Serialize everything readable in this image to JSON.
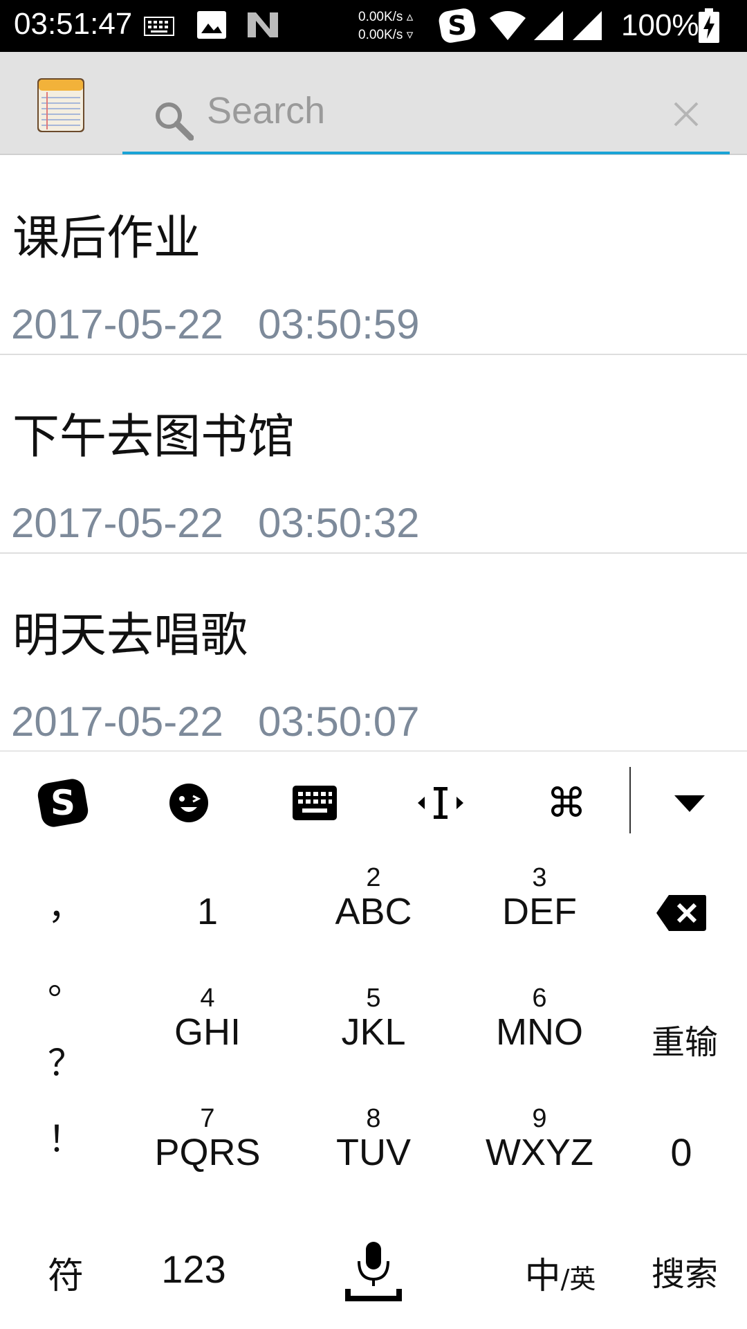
{
  "status_bar": {
    "time": "03:51:47",
    "net_up": "0.00K/s",
    "net_down": "0.00K/s",
    "battery": "100%",
    "icons": [
      "keyboard-icon",
      "image-icon",
      "n-icon",
      "sogou-icon",
      "wifi-icon",
      "signal-icon",
      "signal-icon",
      "battery-charging-icon"
    ]
  },
  "toolbar": {
    "app_icon": "notepad-icon",
    "search_placeholder": "Search",
    "search_value": "",
    "accent_color": "#1aa3d6"
  },
  "notes": [
    {
      "title": "课后作业",
      "date": "2017-05-22",
      "time": "03:50:59"
    },
    {
      "title": "下午去图书馆",
      "date": "2017-05-22",
      "time": "03:50:32"
    },
    {
      "title": "明天去唱歌",
      "date": "2017-05-22",
      "time": "03:50:07"
    }
  ],
  "keyboard": {
    "toolbar_icons": [
      "sogou-logo-icon",
      "emoji-icon",
      "keyboard-icon",
      "cursor-icon",
      "command-icon",
      "collapse-icon"
    ],
    "punctuation": [
      "，",
      "。",
      "？",
      "！"
    ],
    "keys": [
      {
        "digit": "",
        "letters": "1"
      },
      {
        "digit": "2",
        "letters": "ABC"
      },
      {
        "digit": "3",
        "letters": "DEF"
      },
      {
        "digit": "4",
        "letters": "GHI"
      },
      {
        "digit": "5",
        "letters": "JKL"
      },
      {
        "digit": "6",
        "letters": "MNO"
      },
      {
        "digit": "7",
        "letters": "PQRS"
      },
      {
        "digit": "8",
        "letters": "TUV"
      },
      {
        "digit": "9",
        "letters": "WXYZ"
      }
    ],
    "reenter_label": "重输",
    "zero_label": "0",
    "symbols_label": "符",
    "numeric_label": "123",
    "lang_main": "中",
    "lang_sub": "/英",
    "search_label": "搜索"
  }
}
